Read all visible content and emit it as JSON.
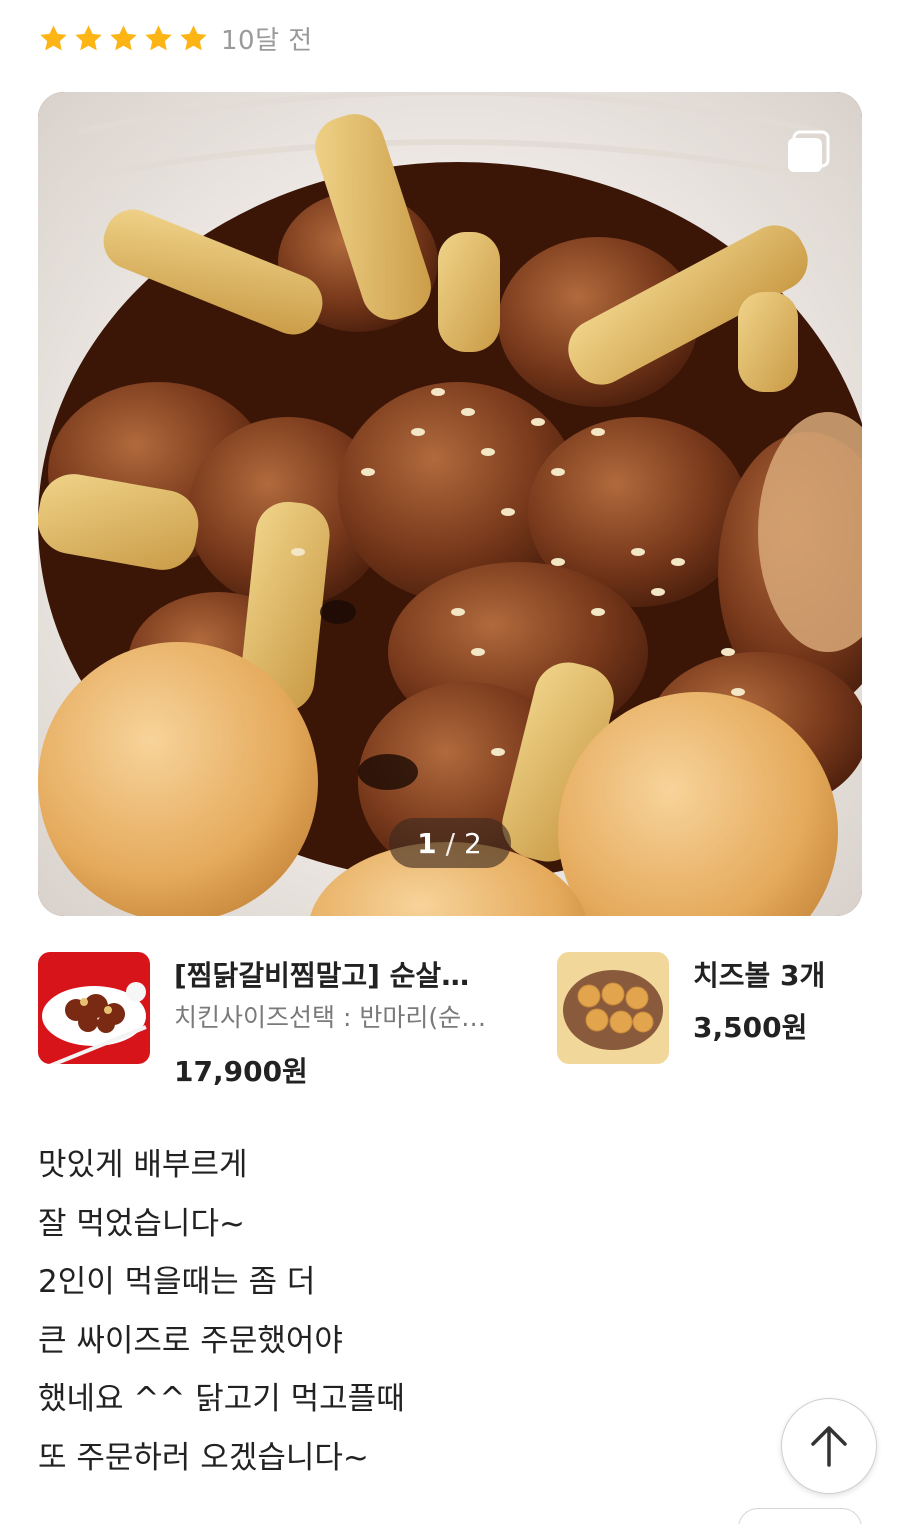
{
  "review": {
    "rating": 5,
    "max_rating": 5,
    "time_ago": "10달 전",
    "star_color": "#FDB515",
    "photo": {
      "current": "1",
      "separator": "/",
      "total": "2"
    },
    "body_lines": [
      "맛있게 배부르게",
      "잘 먹었습니다~",
      "2인이 먹을때는 좀 더",
      "큰 싸이즈로 주문했어야",
      "했네요 ^^ 닭고기 먹고플때",
      "또 주문하러 오겠습니다~"
    ]
  },
  "ordered_items": [
    {
      "name": "[찜닭갈비찜말고] 순살숯…",
      "option": "치킨사이즈선택 : 반마리(순…",
      "price": "17,900원"
    },
    {
      "name": "치즈볼 3개",
      "price": "3,500원"
    }
  ],
  "icons": {
    "multi_photo": "multi-photo-icon",
    "scroll_top": "arrow-up-icon",
    "star": "star-icon"
  }
}
